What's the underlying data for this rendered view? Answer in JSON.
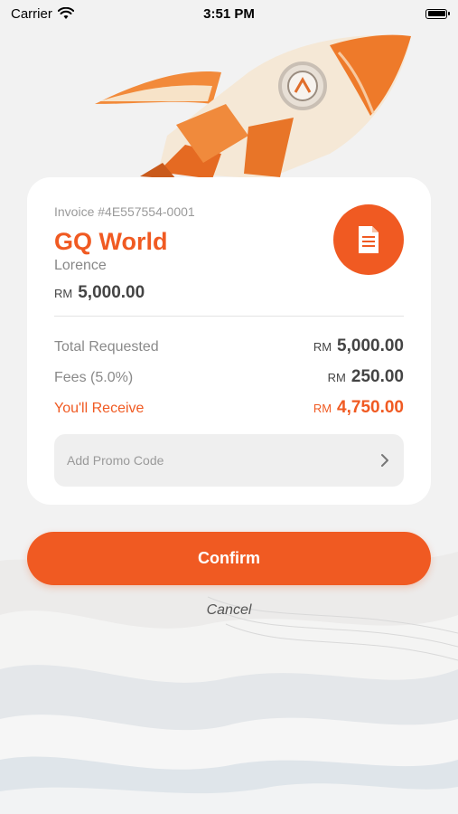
{
  "status_bar": {
    "carrier": "Carrier",
    "time": "3:51 PM"
  },
  "invoice": {
    "number": "Invoice #4E557554-0001",
    "merchant": "GQ World",
    "payer": "Lorence",
    "currency": "RM",
    "amount": "5,000.00"
  },
  "breakdown": [
    {
      "label": "Total Requested",
      "currency": "RM",
      "amount": "5,000.00"
    },
    {
      "label": "Fees (5.0%)",
      "currency": "RM",
      "amount": "250.00"
    },
    {
      "label": "You'll Receive",
      "currency": "RM",
      "amount": "4,750.00"
    }
  ],
  "promo": {
    "label": "Add Promo Code"
  },
  "actions": {
    "confirm": "Confirm",
    "cancel": "Cancel"
  },
  "icons": {
    "document": "document-icon",
    "promo_chevron": "chevron-right-icon"
  },
  "colors": {
    "accent": "#f05a22",
    "card": "#ffffff",
    "background": "#f2f2f2"
  }
}
